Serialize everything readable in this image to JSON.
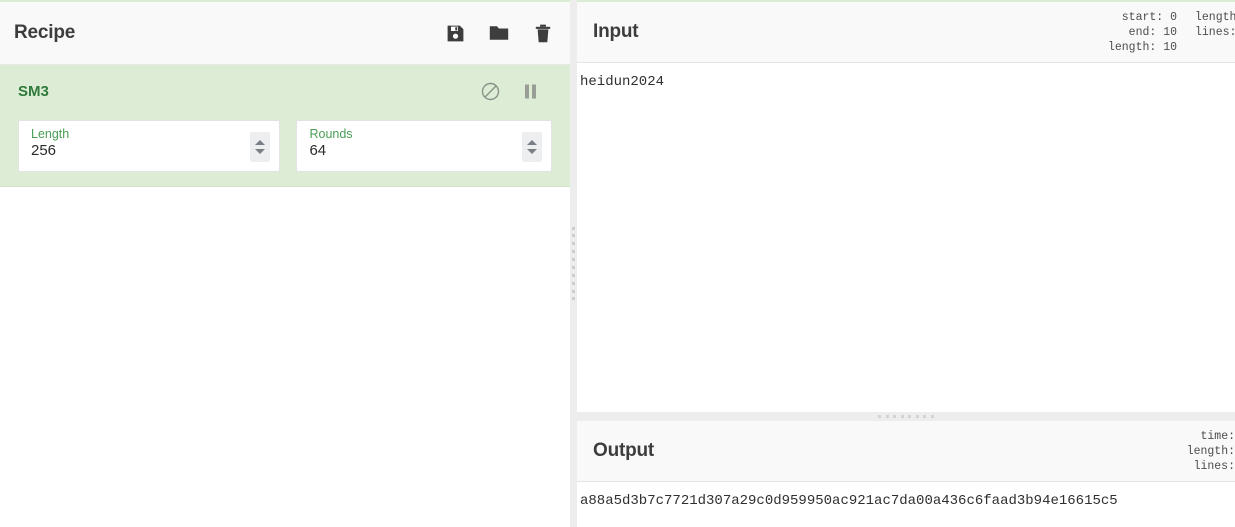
{
  "recipe": {
    "title": "Recipe",
    "controls": [
      {
        "name": "save-recipe-button",
        "icon": "floppy-disk-icon",
        "label": "Save recipe"
      },
      {
        "name": "load-recipe-button",
        "icon": "folder-icon",
        "label": "Load recipe"
      },
      {
        "name": "clear-recipe-button",
        "icon": "trash-icon",
        "label": "Clear recipe"
      }
    ],
    "operation": {
      "name": "SM3",
      "disable_icon": "circle-slash-icon",
      "breakpoint_icon": "pause-icon",
      "args": [
        {
          "label": "Length",
          "value": "256"
        },
        {
          "label": "Rounds",
          "value": "64"
        }
      ]
    },
    "accent_color": "#2f7a3c",
    "operation_bg": "#dcecd5"
  },
  "input": {
    "title": "Input",
    "stats": {
      "start_label": "start:",
      "start_value": "0",
      "end_label": "end:",
      "end_value": "10",
      "length_label": "length:",
      "length_value": "10"
    },
    "stats_clipped": {
      "length_label": "length:",
      "lines_label": "lines:"
    },
    "text": "heidun2024"
  },
  "output": {
    "title": "Output",
    "stats": {
      "time_label": "time:",
      "length_label": "length:",
      "lines_label": "lines:"
    },
    "text": "a88a5d3b7c7721d307a29c0d959950ac921ac7da00a436c6faad3b94e16615c5"
  }
}
